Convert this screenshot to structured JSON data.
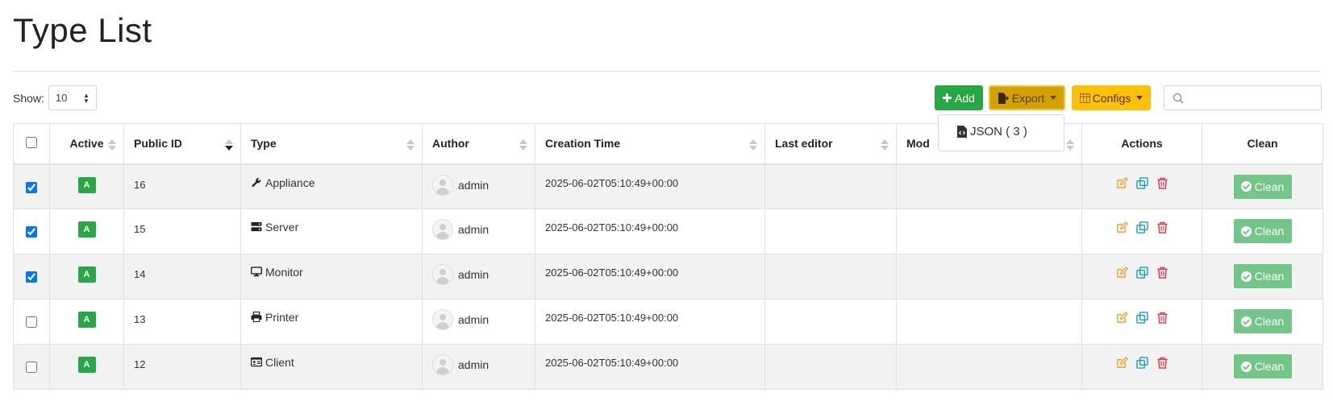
{
  "page": {
    "title": "Type List"
  },
  "controls": {
    "show_label": "Show:",
    "show_value": "10",
    "add_label": "Add",
    "export_label": "Export",
    "configs_label": "Configs",
    "search_placeholder": ""
  },
  "export_menu": {
    "items": [
      {
        "label": "JSON ( 3 )"
      }
    ]
  },
  "table": {
    "columns": [
      "Active",
      "Public ID",
      "Type",
      "Author",
      "Creation Time",
      "Last editor",
      "Mod",
      "Actions",
      "Clean"
    ],
    "sorted_column": "Public ID",
    "sort_direction": "descending",
    "active_badge": "A",
    "clean_label": "Clean",
    "rows": [
      {
        "selected": true,
        "public_id": "16",
        "type": "Appliance",
        "type_icon": "wrench-icon",
        "author": "admin",
        "creation_time": "2025-06-02T05:10:49+00:00",
        "last_editor": "",
        "modified": ""
      },
      {
        "selected": true,
        "public_id": "15",
        "type": "Server",
        "type_icon": "server-icon",
        "author": "admin",
        "creation_time": "2025-06-02T05:10:49+00:00",
        "last_editor": "",
        "modified": ""
      },
      {
        "selected": true,
        "public_id": "14",
        "type": "Monitor",
        "type_icon": "monitor-icon",
        "author": "admin",
        "creation_time": "2025-06-02T05:10:49+00:00",
        "last_editor": "",
        "modified": ""
      },
      {
        "selected": false,
        "public_id": "13",
        "type": "Printer",
        "type_icon": "printer-icon",
        "author": "admin",
        "creation_time": "2025-06-02T05:10:49+00:00",
        "last_editor": "",
        "modified": ""
      },
      {
        "selected": false,
        "public_id": "12",
        "type": "Client",
        "type_icon": "id-card-icon",
        "author": "admin",
        "creation_time": "2025-06-02T05:10:49+00:00",
        "last_editor": "",
        "modified": ""
      }
    ]
  },
  "colors": {
    "add": "#28a745",
    "export": "#d4a200",
    "configs": "#ffc107",
    "active_badge": "#28a745",
    "clean": "#74c58a",
    "edit_icon": "#f0a030",
    "copy_icon": "#17a2b8",
    "delete_icon": "#dc3545"
  }
}
